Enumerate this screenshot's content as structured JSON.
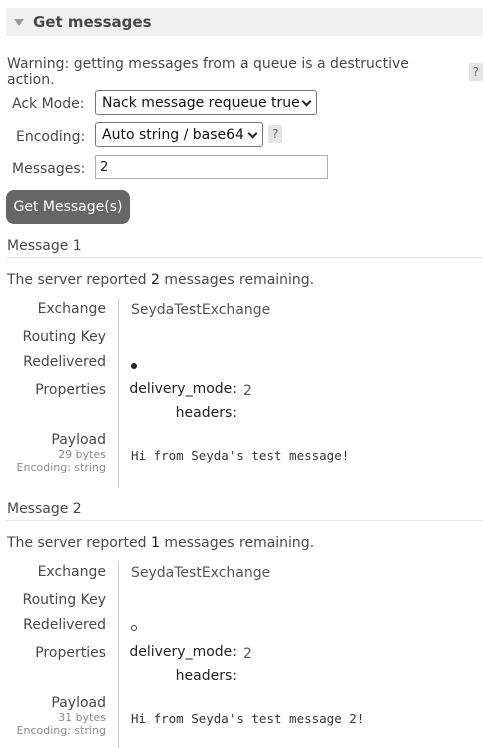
{
  "section": {
    "title": "Get messages"
  },
  "warning": {
    "text": "Warning: getting messages from a queue is a destructive action.",
    "help": "?"
  },
  "form": {
    "ack_mode_label": "Ack Mode:",
    "ack_mode_value": "Nack message requeue true",
    "encoding_label": "Encoding:",
    "encoding_value": "Auto string / base64",
    "encoding_help": "?",
    "messages_label": "Messages:",
    "messages_value": "2",
    "get_button": "Get Message(s)"
  },
  "messages": [
    {
      "title": "Message 1",
      "remaining_prefix": "The server reported ",
      "remaining_count": "2",
      "remaining_suffix": " messages remaining.",
      "exchange_label": "Exchange",
      "exchange": "SeydaTestExchange",
      "routing_key_label": "Routing Key",
      "routing_key": "",
      "redelivered_label": "Redelivered",
      "redelivered": true,
      "properties_label": "Properties",
      "delivery_mode_key": "delivery_mode:",
      "delivery_mode": "2",
      "headers_key": "headers:",
      "payload_label": "Payload",
      "payload_size": "29 bytes",
      "payload_encoding": "Encoding: string",
      "payload": "Hi from Seyda's test message!"
    },
    {
      "title": "Message 2",
      "remaining_prefix": "The server reported ",
      "remaining_count": "1",
      "remaining_suffix": " messages remaining.",
      "exchange_label": "Exchange",
      "exchange": "SeydaTestExchange",
      "routing_key_label": "Routing Key",
      "routing_key": "",
      "redelivered_label": "Redelivered",
      "redelivered": false,
      "properties_label": "Properties",
      "delivery_mode_key": "delivery_mode:",
      "delivery_mode": "2",
      "headers_key": "headers:",
      "payload_label": "Payload",
      "payload_size": "31 bytes",
      "payload_encoding": "Encoding: string",
      "payload": "Hi from Seyda's test message 2!"
    }
  ]
}
